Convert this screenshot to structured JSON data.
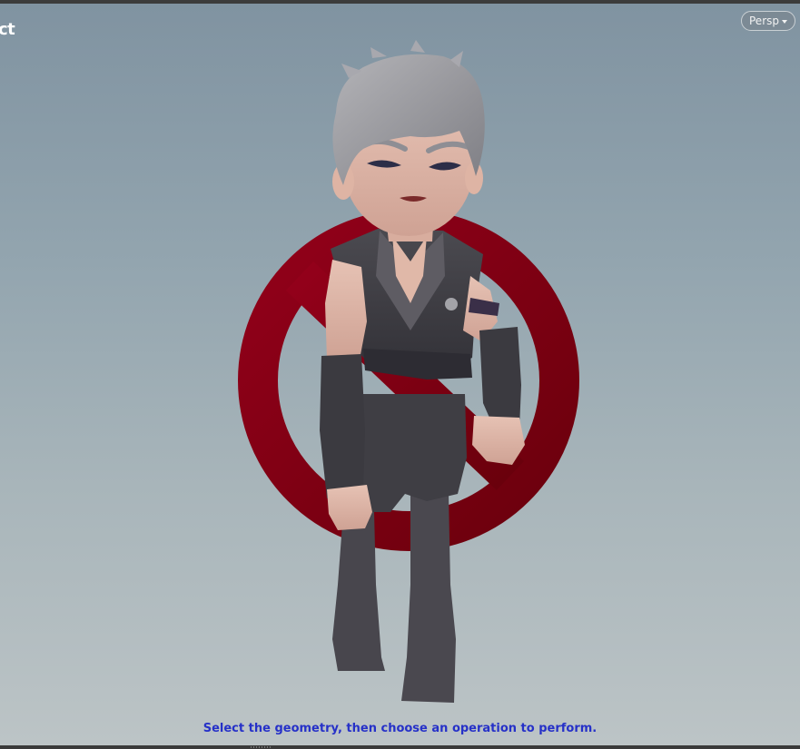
{
  "viewport": {
    "title_fragment": "ct",
    "camera_menu": {
      "label": "Persp",
      "icon": "chevron-down-icon"
    },
    "prompt_text": "Select the geometry, then choose an operation to perform.",
    "colors": {
      "background_top": "#8093a1",
      "background_bottom": "#bcc4c6",
      "prompt": "#2631c8",
      "no_symbol": "#7e0010"
    }
  }
}
